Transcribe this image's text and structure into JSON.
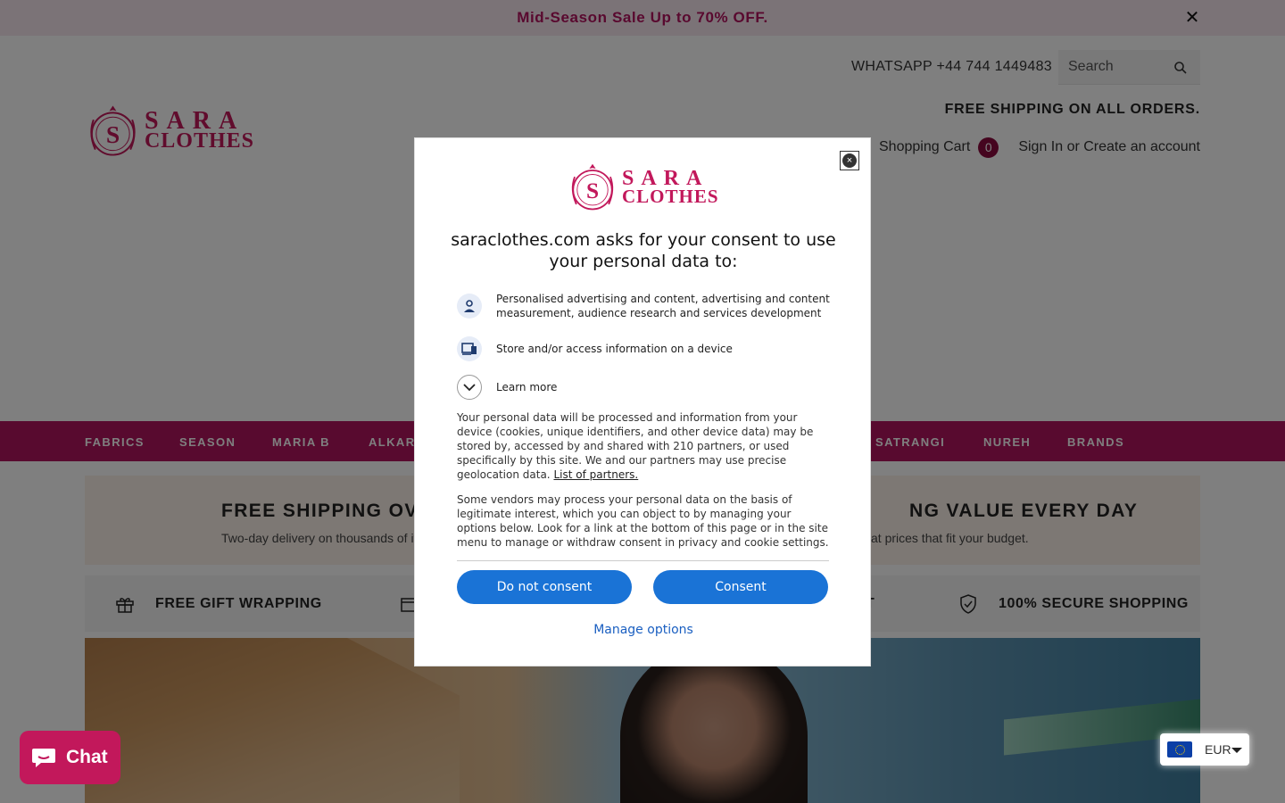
{
  "announcement": {
    "text": "Mid-Season Sale Up to 70% OFF.",
    "close": "✕"
  },
  "header": {
    "logo": {
      "line1": "SARA",
      "line2": "CLOTHES"
    },
    "whatsapp": "WHATSAPP +44 744 1449483",
    "search_placeholder": "Search",
    "free_shipping": "FREE SHIPPING ON ALL ORDERS.",
    "cart": {
      "label": "Shopping Cart",
      "count": "0"
    },
    "sign_in": "Sign In",
    "or": " or ",
    "create_account": "Create an account"
  },
  "nav": {
    "items": [
      "FABRICS",
      "SEASON",
      "MARIA B",
      "ALKARAM",
      "SATRANGI",
      "NUREH",
      "BRANDS"
    ]
  },
  "promo": {
    "left_title": "FREE SHIPPING OVER",
    "left_sub": "Two-day delivery on thousands of items",
    "right_title": "NG VALUE EVERY DAY",
    "right_sub": "lity at prices that fit your budget."
  },
  "features": [
    {
      "label": "FREE GIFT WRAPPING",
      "icon": "gift-icon"
    },
    {
      "label": "",
      "icon": "box-icon"
    },
    {
      "label": "T",
      "icon": ""
    },
    {
      "label": "100% SECURE SHOPPING",
      "icon": "shield-check-icon"
    }
  ],
  "chat": {
    "label": "Chat"
  },
  "currency": {
    "code": "EUR"
  },
  "consent": {
    "logo": {
      "line1": "SARA",
      "line2": "CLOTHES"
    },
    "title": "saraclothes.com asks for your consent to use your personal data to:",
    "purposes": [
      "Personalised advertising and content, advertising and content measurement, audience research and services development",
      "Store and/or access information on a device"
    ],
    "learn_more": "Learn more",
    "para1": "Your personal data will be processed and information from your device (cookies, unique identifiers, and other device data) may be stored by, accessed by and shared with 210 partners, or used specifically by this site. We and our partners may use precise geolocation data.",
    "partners_link": "List of partners.",
    "para2": "Some vendors may process your personal data on the basis of legitimate interest, which you can object to by managing your options below. Look for a link at the bottom of this page or in the site menu to manage or withdraw consent in privacy and cookie settings.",
    "do_not_consent": "Do not consent",
    "consent": "Consent",
    "manage_options": "Manage options"
  },
  "colors": {
    "brand": "#b0155f",
    "button": "#1a73d6"
  }
}
